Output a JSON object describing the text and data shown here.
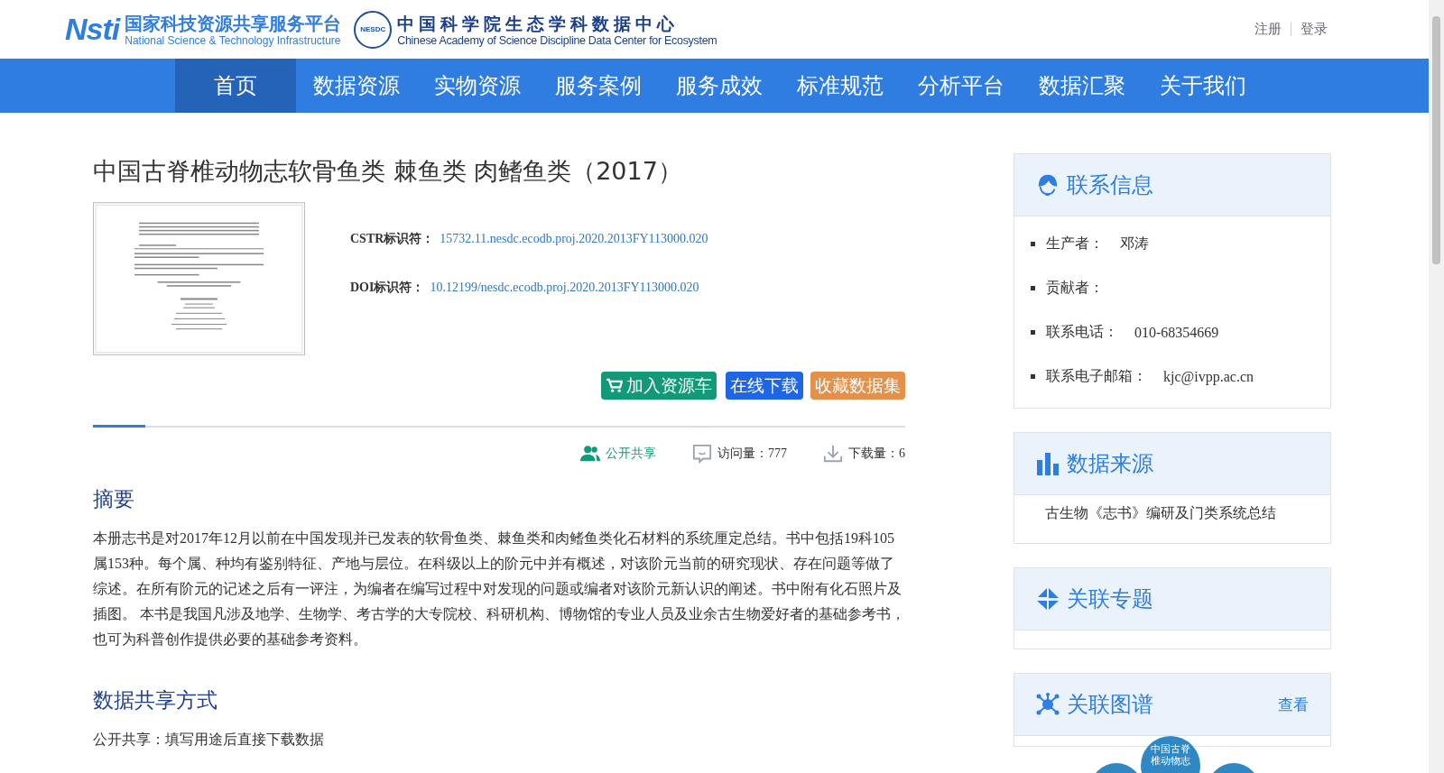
{
  "header": {
    "platform_mark": "Nsti",
    "platform_name": "国家科技资源共享服务平台",
    "platform_name_en": "National Science & Technology Infrastructure",
    "center_badge": "NESDC",
    "center_name": "中国科学院生态学科数据中心",
    "center_name_en": "Chinese Academy of Science Discipline Data Center for Ecosystem",
    "auth_links": [
      "注册",
      "登录"
    ]
  },
  "nav": {
    "items": [
      {
        "label": "首页",
        "selected": true
      },
      {
        "label": "数据资源",
        "selected": false
      },
      {
        "label": "实物资源",
        "selected": false
      },
      {
        "label": "服务案例",
        "selected": false
      },
      {
        "label": "服务成效",
        "selected": false
      },
      {
        "label": "标准规范",
        "selected": false
      },
      {
        "label": "分析平台",
        "selected": false
      },
      {
        "label": "数据汇聚",
        "selected": false
      },
      {
        "label": "关于我们",
        "selected": false
      }
    ]
  },
  "dataset": {
    "title": "中国古脊椎动物志软骨鱼类 棘鱼类 肉鳍鱼类（2017）",
    "identifiers": [
      {
        "label": "CSTR标识符：",
        "value": "15732.11.nesdc.ecodb.proj.2020.2013FY113000.020"
      },
      {
        "label": "DOI标识符：",
        "value": "10.12199/nesdc.ecodb.proj.2020.2013FY113000.020"
      }
    ],
    "buttons": [
      {
        "label": "加入资源车",
        "kind": "cart"
      },
      {
        "label": "在线下载",
        "kind": "download"
      },
      {
        "label": "收藏数据集",
        "kind": "favorite"
      }
    ],
    "stats": [
      {
        "kind": "share",
        "label": "公开共享"
      },
      {
        "kind": "visits",
        "label": "访问量：777"
      },
      {
        "kind": "downloads",
        "label": "下载量：6"
      }
    ],
    "sections": [
      {
        "heading": "摘要",
        "text": "本册志书是对2017年12月以前在中国发现并已发表的软骨鱼类、棘鱼类和肉鳍鱼类化石材料的系统厘定总结。书中包括19科105属153种。每个属、种均有鉴别特征、产地与层位。在科级以上的阶元中并有概述，对该阶元当前的研究现状、存在问题等做了综述。在所有阶元的记述之后有一评注，为编者在编写过程中对发现的问题或编者对该阶元新认识的阐述。书中附有化石照片及插图。 本书是我国凡涉及地学、生物学、考古学的大专院校、科研机构、博物馆的专业人员及业余古生物爱好者的基础参考书，也可为科普创作提供必要的基础参考资料。"
      },
      {
        "heading": "数据共享方式",
        "text": "公开共享：填写用途后直接下载数据"
      }
    ]
  },
  "sidebar": {
    "panels": [
      {
        "kind": "contact",
        "title": "联系信息",
        "items": [
          {
            "label": "生产者：",
            "value": "邓涛"
          },
          {
            "label": "贡献者："
          },
          {
            "label": "联系电话：",
            "value": "010-68354669"
          },
          {
            "label": "联系电子邮箱：",
            "value": "kjc@ivpp.ac.cn"
          }
        ]
      },
      {
        "kind": "source",
        "title": "数据来源",
        "text": "古生物《志书》编研及门类系统总结"
      },
      {
        "kind": "topic",
        "title": "关联专题"
      },
      {
        "kind": "graph",
        "title": "关联图谱",
        "action": "查看",
        "center_node": "中国古脊椎动物志"
      }
    ]
  }
}
